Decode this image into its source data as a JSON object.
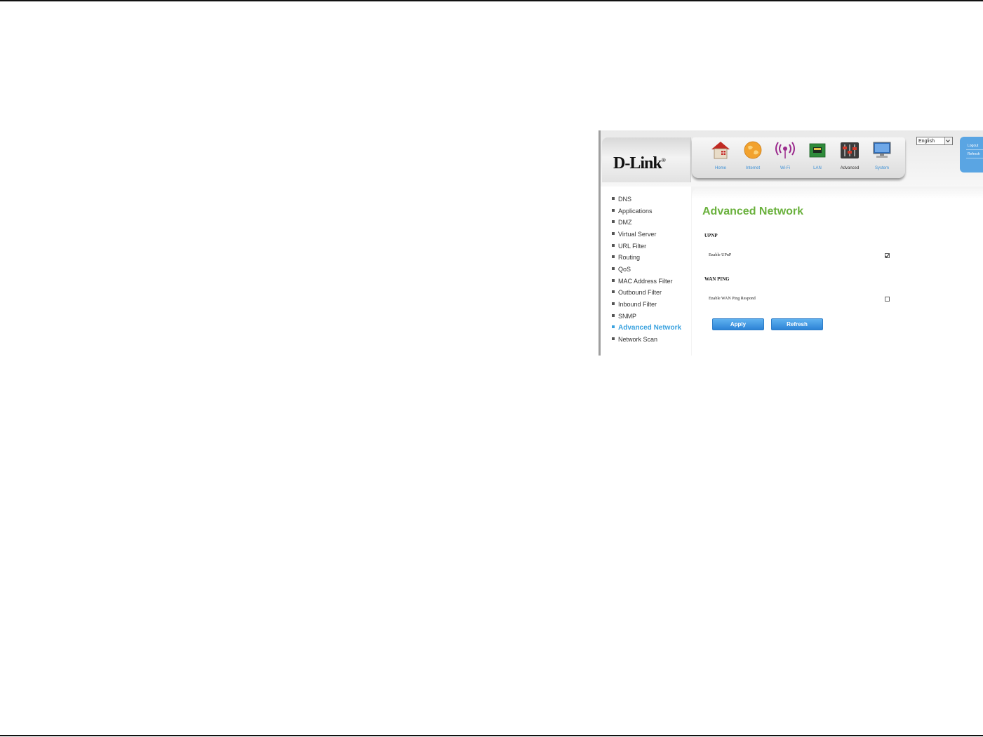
{
  "brand": {
    "logo_text": "D-Link",
    "logo_mark": "®"
  },
  "nav": {
    "items": [
      {
        "label": "Home",
        "icon": "house-icon"
      },
      {
        "label": "Internet",
        "icon": "globe-icon"
      },
      {
        "label": "Wi-Fi",
        "icon": "wifi-antenna-icon"
      },
      {
        "label": "LAN",
        "icon": "network-card-icon"
      },
      {
        "label": "Advanced",
        "icon": "sliders-icon",
        "active": true
      },
      {
        "label": "System",
        "icon": "monitor-icon"
      }
    ]
  },
  "language": {
    "selected": "English"
  },
  "session": {
    "logout_label": "Logout",
    "refresh_label": "Refresh"
  },
  "sidebar": {
    "items": [
      {
        "label": "DNS"
      },
      {
        "label": "Applications"
      },
      {
        "label": "DMZ"
      },
      {
        "label": "Virtual Server"
      },
      {
        "label": "URL Filter"
      },
      {
        "label": "Routing"
      },
      {
        "label": "QoS"
      },
      {
        "label": "MAC Address Filter"
      },
      {
        "label": "Outbound Filter"
      },
      {
        "label": "Inbound Filter"
      },
      {
        "label": "SNMP"
      },
      {
        "label": "Advanced Network",
        "active": true
      },
      {
        "label": "Network Scan"
      }
    ]
  },
  "content": {
    "title": "Advanced Network",
    "upnp": {
      "heading": "UPNP",
      "label": "Enable UPnP",
      "checked": true
    },
    "wan_ping": {
      "heading": "WAN PING",
      "label": "Enable WAN Ping Respond",
      "checked": false
    },
    "apply_label": "Apply",
    "refresh_label": "Refresh"
  },
  "colors": {
    "accent_green": "#6ab13d",
    "accent_blue": "#3aa2df",
    "button_blue": "#2d83d6"
  }
}
